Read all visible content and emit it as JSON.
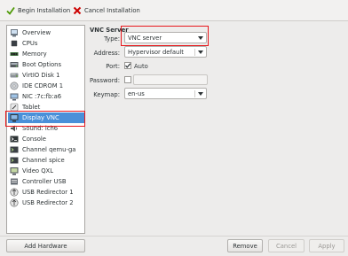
{
  "toolbar": {
    "begin_label": "Begin Installation",
    "cancel_label": "Cancel Installation"
  },
  "sidebar": {
    "items": [
      {
        "label": "Overview",
        "icon": "overview-icon"
      },
      {
        "label": "CPUs",
        "icon": "cpu-icon"
      },
      {
        "label": "Memory",
        "icon": "memory-icon"
      },
      {
        "label": "Boot Options",
        "icon": "boot-options-icon"
      },
      {
        "label": "VirtIO Disk 1",
        "icon": "disk-icon"
      },
      {
        "label": "IDE CDROM 1",
        "icon": "cdrom-icon"
      },
      {
        "label": "NIC :7c:fb:a6",
        "icon": "nic-icon"
      },
      {
        "label": "Tablet",
        "icon": "tablet-icon"
      },
      {
        "label": "Display VNC",
        "icon": "display-icon"
      },
      {
        "label": "Sound: ich6",
        "icon": "sound-icon"
      },
      {
        "label": "Console",
        "icon": "console-icon"
      },
      {
        "label": "Channel qemu-ga",
        "icon": "channel-icon"
      },
      {
        "label": "Channel spice",
        "icon": "channel-icon"
      },
      {
        "label": "Video QXL",
        "icon": "video-icon"
      },
      {
        "label": "Controller USB",
        "icon": "controller-icon"
      },
      {
        "label": "USB Redirector 1",
        "icon": "usb-redirector-icon"
      },
      {
        "label": "USB Redirector 2",
        "icon": "usb-redirector-icon"
      }
    ],
    "selected_index": 8,
    "add_hardware_label": "Add Hardware"
  },
  "details": {
    "section_title": "VNC Server",
    "type_label": "Type:",
    "type_value": "VNC server",
    "address_label": "Address:",
    "address_value": "Hypervisor default",
    "port_label": "Port:",
    "port_auto_label": "Auto",
    "port_auto_checked": true,
    "password_label": "Password:",
    "password_checked": false,
    "keymap_label": "Keymap:",
    "keymap_value": "en-us"
  },
  "footer": {
    "remove_label": "Remove",
    "cancel_label": "Cancel",
    "apply_label": "Apply"
  },
  "colors": {
    "selection": "#4a90d9",
    "highlight": "#e8161b"
  }
}
